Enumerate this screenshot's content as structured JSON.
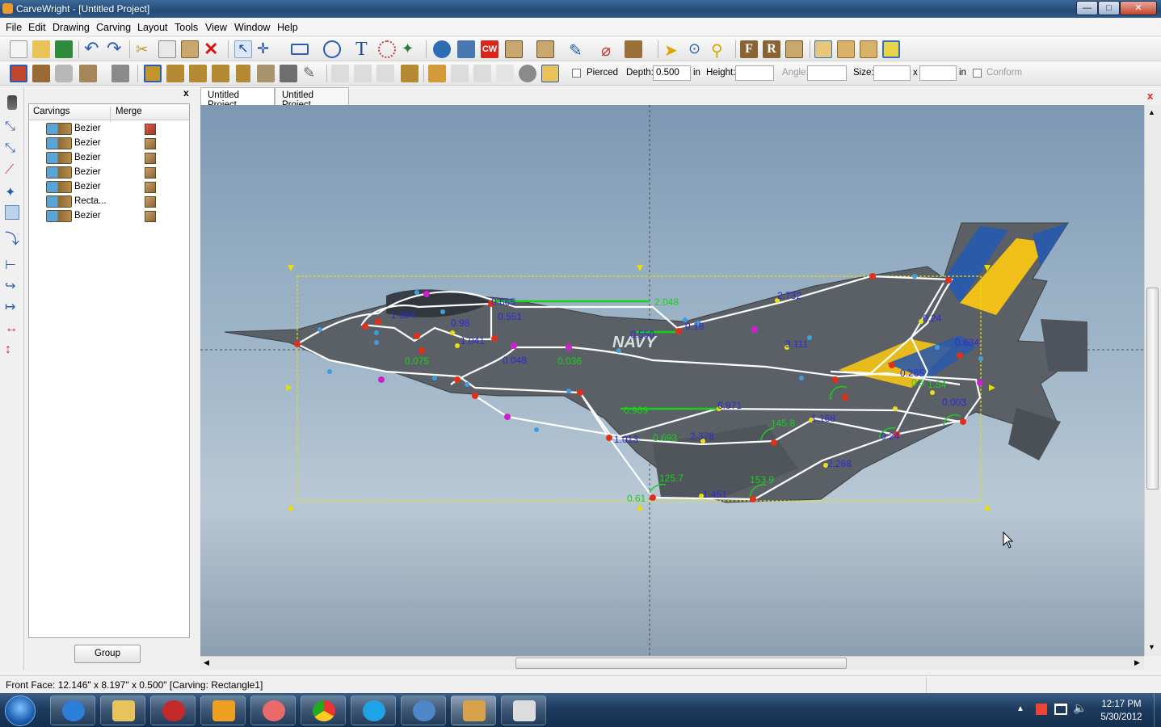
{
  "window": {
    "title": "CarveWright - [Untitled Project]",
    "minimize": "—",
    "maximize": "□",
    "close": "✕"
  },
  "menu": [
    "File",
    "Edit",
    "Drawing",
    "Carving",
    "Layout",
    "Tools",
    "View",
    "Window",
    "Help"
  ],
  "toolbar2": {
    "pierced_label": "Pierced",
    "depth_label": "Depth:",
    "depth_value": "0.500",
    "depth_unit": "in",
    "height_label": "Height:",
    "height_value": "",
    "angle_label": "Angle:",
    "angle_value": "",
    "size_label": "Size:",
    "size_w": "",
    "size_x": "x",
    "size_h": "",
    "size_unit": "in",
    "conform_label": "Conform"
  },
  "panel": {
    "col_carvings": "Carvings",
    "col_merge": "Merge",
    "close": "x",
    "items": [
      {
        "label": "Bezier",
        "merge": "red"
      },
      {
        "label": "Bezier",
        "merge": "plain"
      },
      {
        "label": "Bezier",
        "merge": "plain"
      },
      {
        "label": "Bezier",
        "merge": "plain"
      },
      {
        "label": "Bezier",
        "merge": "plain"
      },
      {
        "label": "Recta...",
        "merge": "plain"
      },
      {
        "label": "Bezier",
        "merge": "plain"
      }
    ],
    "group_button": "Group"
  },
  "tabs": [
    "Untitled Project",
    "Untitled Project"
  ],
  "canvas": {
    "close": "x",
    "aircraft_text": "NAVY",
    "green_dims": [
      "2.048",
      "0.075",
      "0.036",
      "0.969",
      "0.693",
      "125.7",
      "153.9",
      "145.8",
      "0.61",
      "0.5",
      "1.54"
    ],
    "blue_dims": [
      "2.732",
      "0.550",
      "3.111",
      "6.971",
      "2.378",
      "1.013",
      "1.451",
      "2.268",
      "1.168",
      "0.551",
      "0.98",
      "1.041",
      "1.354",
      "0.684",
      "0.24",
      "0.265",
      "0.18",
      "0.003",
      "0.665",
      "0.048",
      "0.24"
    ]
  },
  "status": {
    "text": "Front Face: 12.146\" x 8.197\" x 0.500\"   [Carving: Rectangle1]"
  },
  "taskbar": {
    "time": "12:17 PM",
    "date": "5/30/2012"
  }
}
